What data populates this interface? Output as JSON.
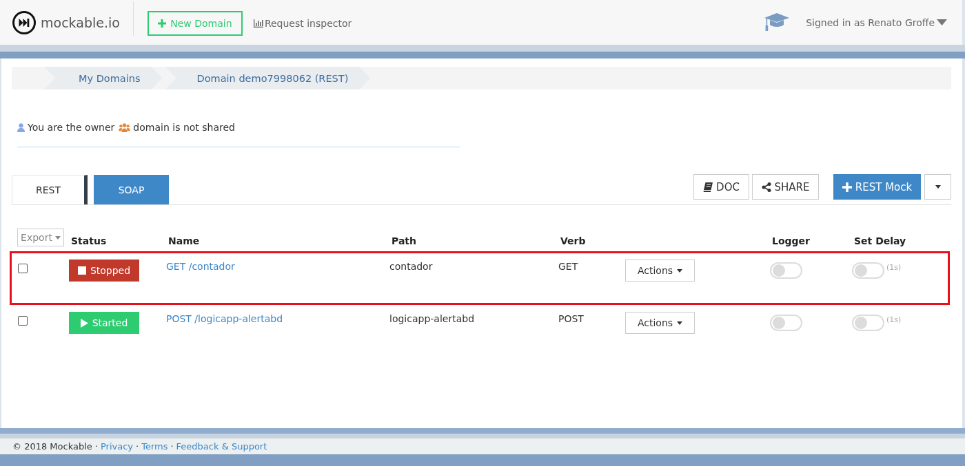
{
  "header": {
    "logo": "mockable.io",
    "new_domain_button": "New Domain",
    "request_inspector_link": "Request inspector",
    "user_menu": "Signed in as Renato Groffe"
  },
  "breadcrumb": [
    {
      "label": "My Domains"
    },
    {
      "label": "Domain demo7998062 (REST)"
    }
  ],
  "ownership": {
    "owner_text": "You are the owner",
    "sharing_text": "domain is not shared"
  },
  "tabs": [
    {
      "label": "REST",
      "selected": true
    },
    {
      "label": "SOAP",
      "selected": false
    }
  ],
  "toolbar": {
    "doc_button": "DOC",
    "share_button": "SHARE",
    "add_button": "REST Mock"
  },
  "table": {
    "export_menu": "Export",
    "columns": [
      "Status",
      "Name",
      "Path",
      "Verb",
      "Logger",
      "Set Delay"
    ],
    "rows": [
      {
        "highlighted": true,
        "checked": false,
        "status": {
          "label": "Stopped",
          "kind": "stopped"
        },
        "name": "GET /contador",
        "path": "contador",
        "verb": "GET",
        "actions": "Actions",
        "logger_on": false,
        "delay_on": false,
        "delay_label": "(1s)"
      },
      {
        "highlighted": false,
        "checked": false,
        "status": {
          "label": "Started",
          "kind": "started"
        },
        "name": "POST /logicapp-alertabd",
        "path": "logicapp-alertabd",
        "verb": "POST",
        "actions": "Actions",
        "logger_on": false,
        "delay_on": false,
        "delay_label": "(1s)"
      }
    ]
  },
  "footer": {
    "copyright": "© 2018 Mockable",
    "links": [
      {
        "separator": "·",
        "label": "Privacy"
      },
      {
        "separator": "·",
        "label": "Terms"
      },
      {
        "separator": "·",
        "label": "Feedback & Support"
      }
    ]
  }
}
